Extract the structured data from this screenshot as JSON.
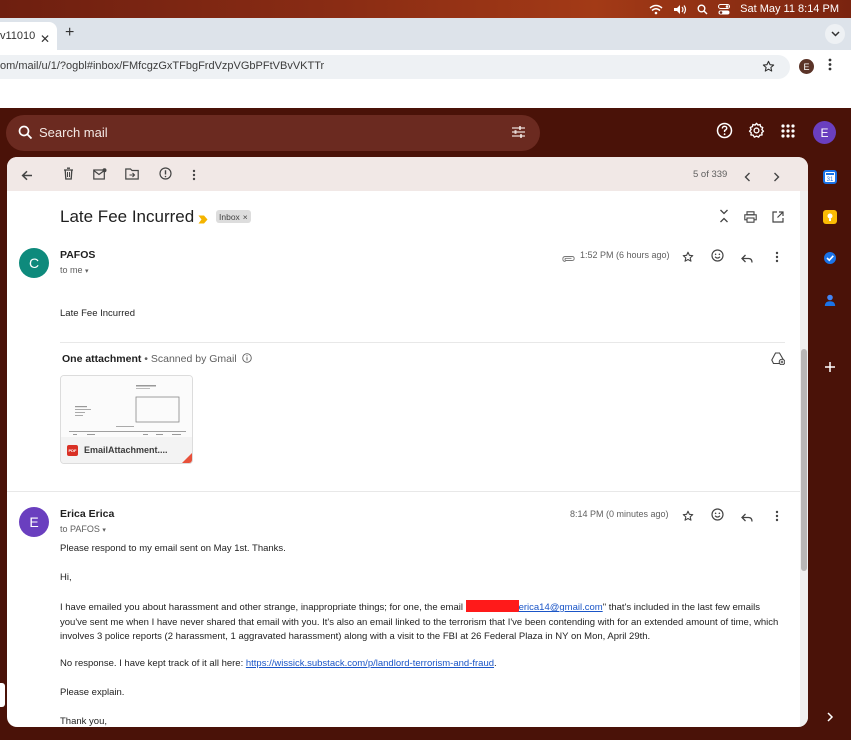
{
  "menubar": {
    "datetime": "Sat May 11  8:14 PM"
  },
  "browser": {
    "tab_title": "v11010",
    "tab_close": "✕",
    "new_tab": "+",
    "url": "om/mail/u/1/?ogbl#inbox/FMfcgzGxTFbgFrdVzpVGbPFtVBvVKTTr",
    "profile_initial": "E"
  },
  "gmail": {
    "search_placeholder": "Search mail",
    "account_initial": "E"
  },
  "toolbar": {
    "pager": "5 of 339"
  },
  "thread": {
    "subject": "Late Fee Incurred",
    "label": "Inbox",
    "label_close": "×"
  },
  "message1": {
    "avatar_initial": "C",
    "avatar_color": "#0e8a7c",
    "sender": "PAFOS",
    "to": "to me",
    "time": "1:52 PM (6 hours ago)",
    "body": "Late Fee Incurred",
    "attachment_heading": "One attachment",
    "attachment_scanned": " •  Scanned by Gmail",
    "attachment_badge": "PDF",
    "attachment_name": "EmailAttachment...."
  },
  "message2": {
    "avatar_initial": "E",
    "avatar_color": "#6a3fbf",
    "sender": "Erica Erica",
    "to": "to PAFOS",
    "time": "8:14 PM (0 minutes ago)",
    "line1": "Please respond to my email sent on May 1st. Thanks.",
    "greeting": "Hi,",
    "para_a": "I have emailed you about harassment and other strange, inappropriate things; for one, the email ",
    "email_visible": "erica14@gmail.com",
    "para_b": "\" that's included in the last few emails you've sent me when I have never shared that email with you. It's also an email linked to the terrorism that I've been contending with for an extended amount of time, which involves 3 police reports (2 harassment, 1 aggravated harassment) along with a visit to the FBI at 26 Federal Plaza in NY on Mon, April 29th.",
    "para2_a": "No response. I have kept track of it all here: ",
    "link": "https://wissick.substack.com/p/landlord-terrorism-and-fraud",
    "para2_b": ".",
    "explain": "Please explain.",
    "signoff": "Thank you,"
  },
  "colors": {
    "gmail_bg": "#4a1208",
    "toolbar_bg": "#f1e8e6",
    "link": "#1a55c7",
    "redaction": "#ff1a1a"
  }
}
